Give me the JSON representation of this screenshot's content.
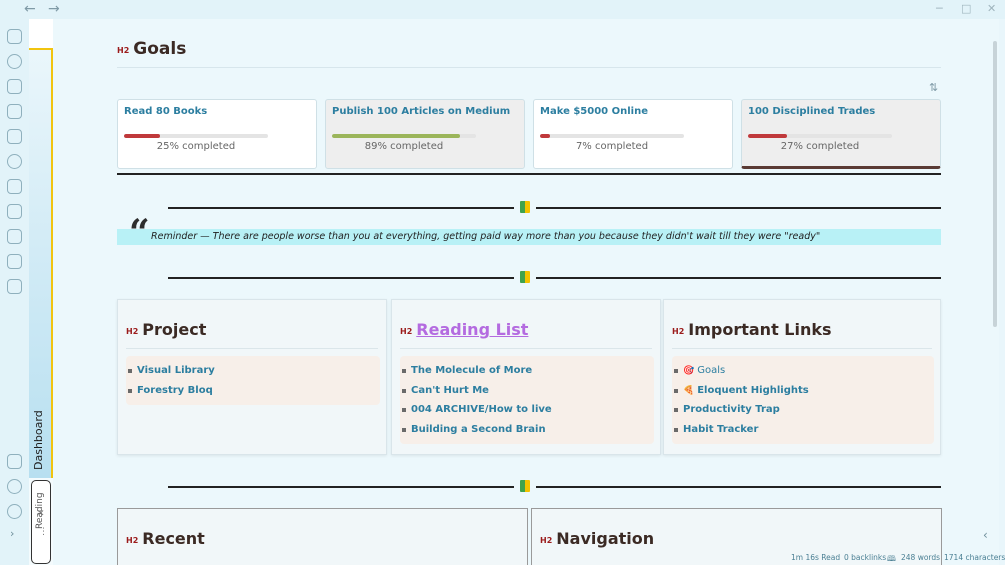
{
  "titlebar": {
    "back_icon": "arrow-left-icon",
    "forward_icon": "arrow-right-icon",
    "minimize": "─",
    "maximize": "□",
    "close": "✕"
  },
  "tabs": {
    "dashboard": "Dashboard",
    "reading": "Reading"
  },
  "goals": {
    "heading_tag": "H2",
    "heading": "Goals",
    "items": [
      {
        "title": "Read 80 Books",
        "progress": 25,
        "label": "25% completed",
        "bar_color": "#c0393b"
      },
      {
        "title": "Publish 100 Articles on Medium",
        "progress": 89,
        "label": "89% completed",
        "bar_color": "#9bb55a"
      },
      {
        "title": "Make $5000 Online",
        "progress": 7,
        "label": "7% completed",
        "bar_color": "#c0393b"
      },
      {
        "title": "100 Disciplined Trades",
        "progress": 27,
        "label": "27% completed",
        "bar_color": "#c0393b"
      }
    ]
  },
  "quote": {
    "text": "Reminder — There are people worse than you at everything, getting paid way more than you because they didn't wait till they were \"ready\""
  },
  "project": {
    "heading_tag": "H2",
    "heading": "Project",
    "items": [
      "Visual Library",
      "Forestry Bloq"
    ]
  },
  "reading_list": {
    "heading_tag": "H2",
    "heading": "Reading List",
    "items": [
      "The Molecule of More",
      "Can't Hurt Me",
      "004 ARCHIVE/How to live",
      "Building a Second Brain"
    ]
  },
  "important_links": {
    "heading_tag": "H2",
    "heading": "Important Links",
    "items": [
      {
        "emoji": "🎯",
        "label": "Goals"
      },
      {
        "emoji": "🍕",
        "label": "Eloquent Highlights"
      },
      {
        "emoji": "",
        "label": "Productivity Trap"
      },
      {
        "emoji": "",
        "label": "Habit Tracker"
      }
    ]
  },
  "recent": {
    "heading_tag": "H2",
    "heading": "Recent"
  },
  "navigation": {
    "heading_tag": "H2",
    "heading": "Navigation"
  },
  "status": {
    "read_time": "1m 16s Read",
    "backlinks": "0 backlinks",
    "words": "248 words",
    "characters": "1714 characters"
  },
  "colors": {
    "accent": "#2c7ea0",
    "heading": "#3b2a24",
    "link_purple": "#b46be0",
    "highlight": "#b8f1f6"
  }
}
